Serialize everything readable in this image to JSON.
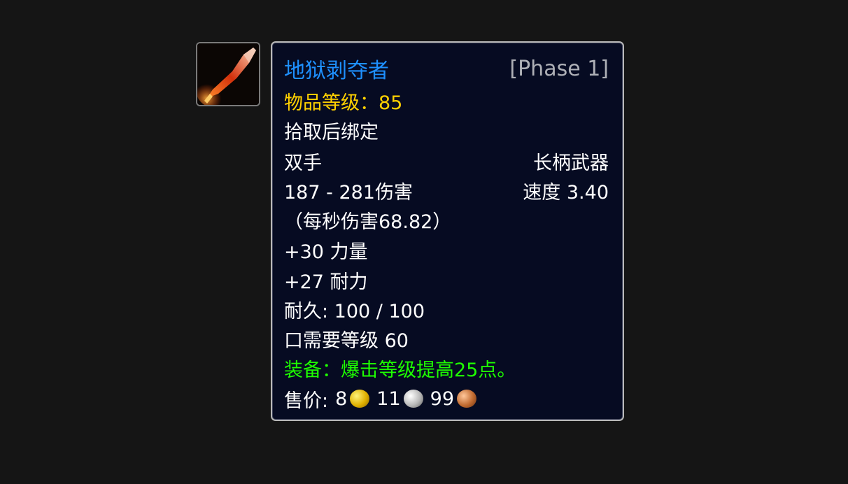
{
  "item": {
    "icon": "polearm-weapon-icon",
    "name": "地狱剥夺者",
    "phase": "[Phase 1]",
    "item_level": "物品等级：85",
    "binding": "拾取后绑定",
    "slot": "双手",
    "type": "长柄武器",
    "damage": "187 - 281伤害",
    "speed": "速度 3.40",
    "dps": "（每秒伤害68.82）",
    "stats": [
      "+30 力量",
      "+27 耐力"
    ],
    "durability": "耐久: 100 / 100",
    "required_level": "口需要等级 60",
    "equip_effect": "装备：爆击等级提高25点。",
    "sell_price": {
      "label": "售价:",
      "gold": "8",
      "silver": "11",
      "copper": "99"
    }
  },
  "colors": {
    "background": "#151515",
    "tooltip_bg": "#060b22",
    "name": "#1e90ff",
    "phase": "#aeb0b6",
    "item_level": "#ffd100",
    "equip": "#1eff00",
    "text": "#ffffff"
  }
}
